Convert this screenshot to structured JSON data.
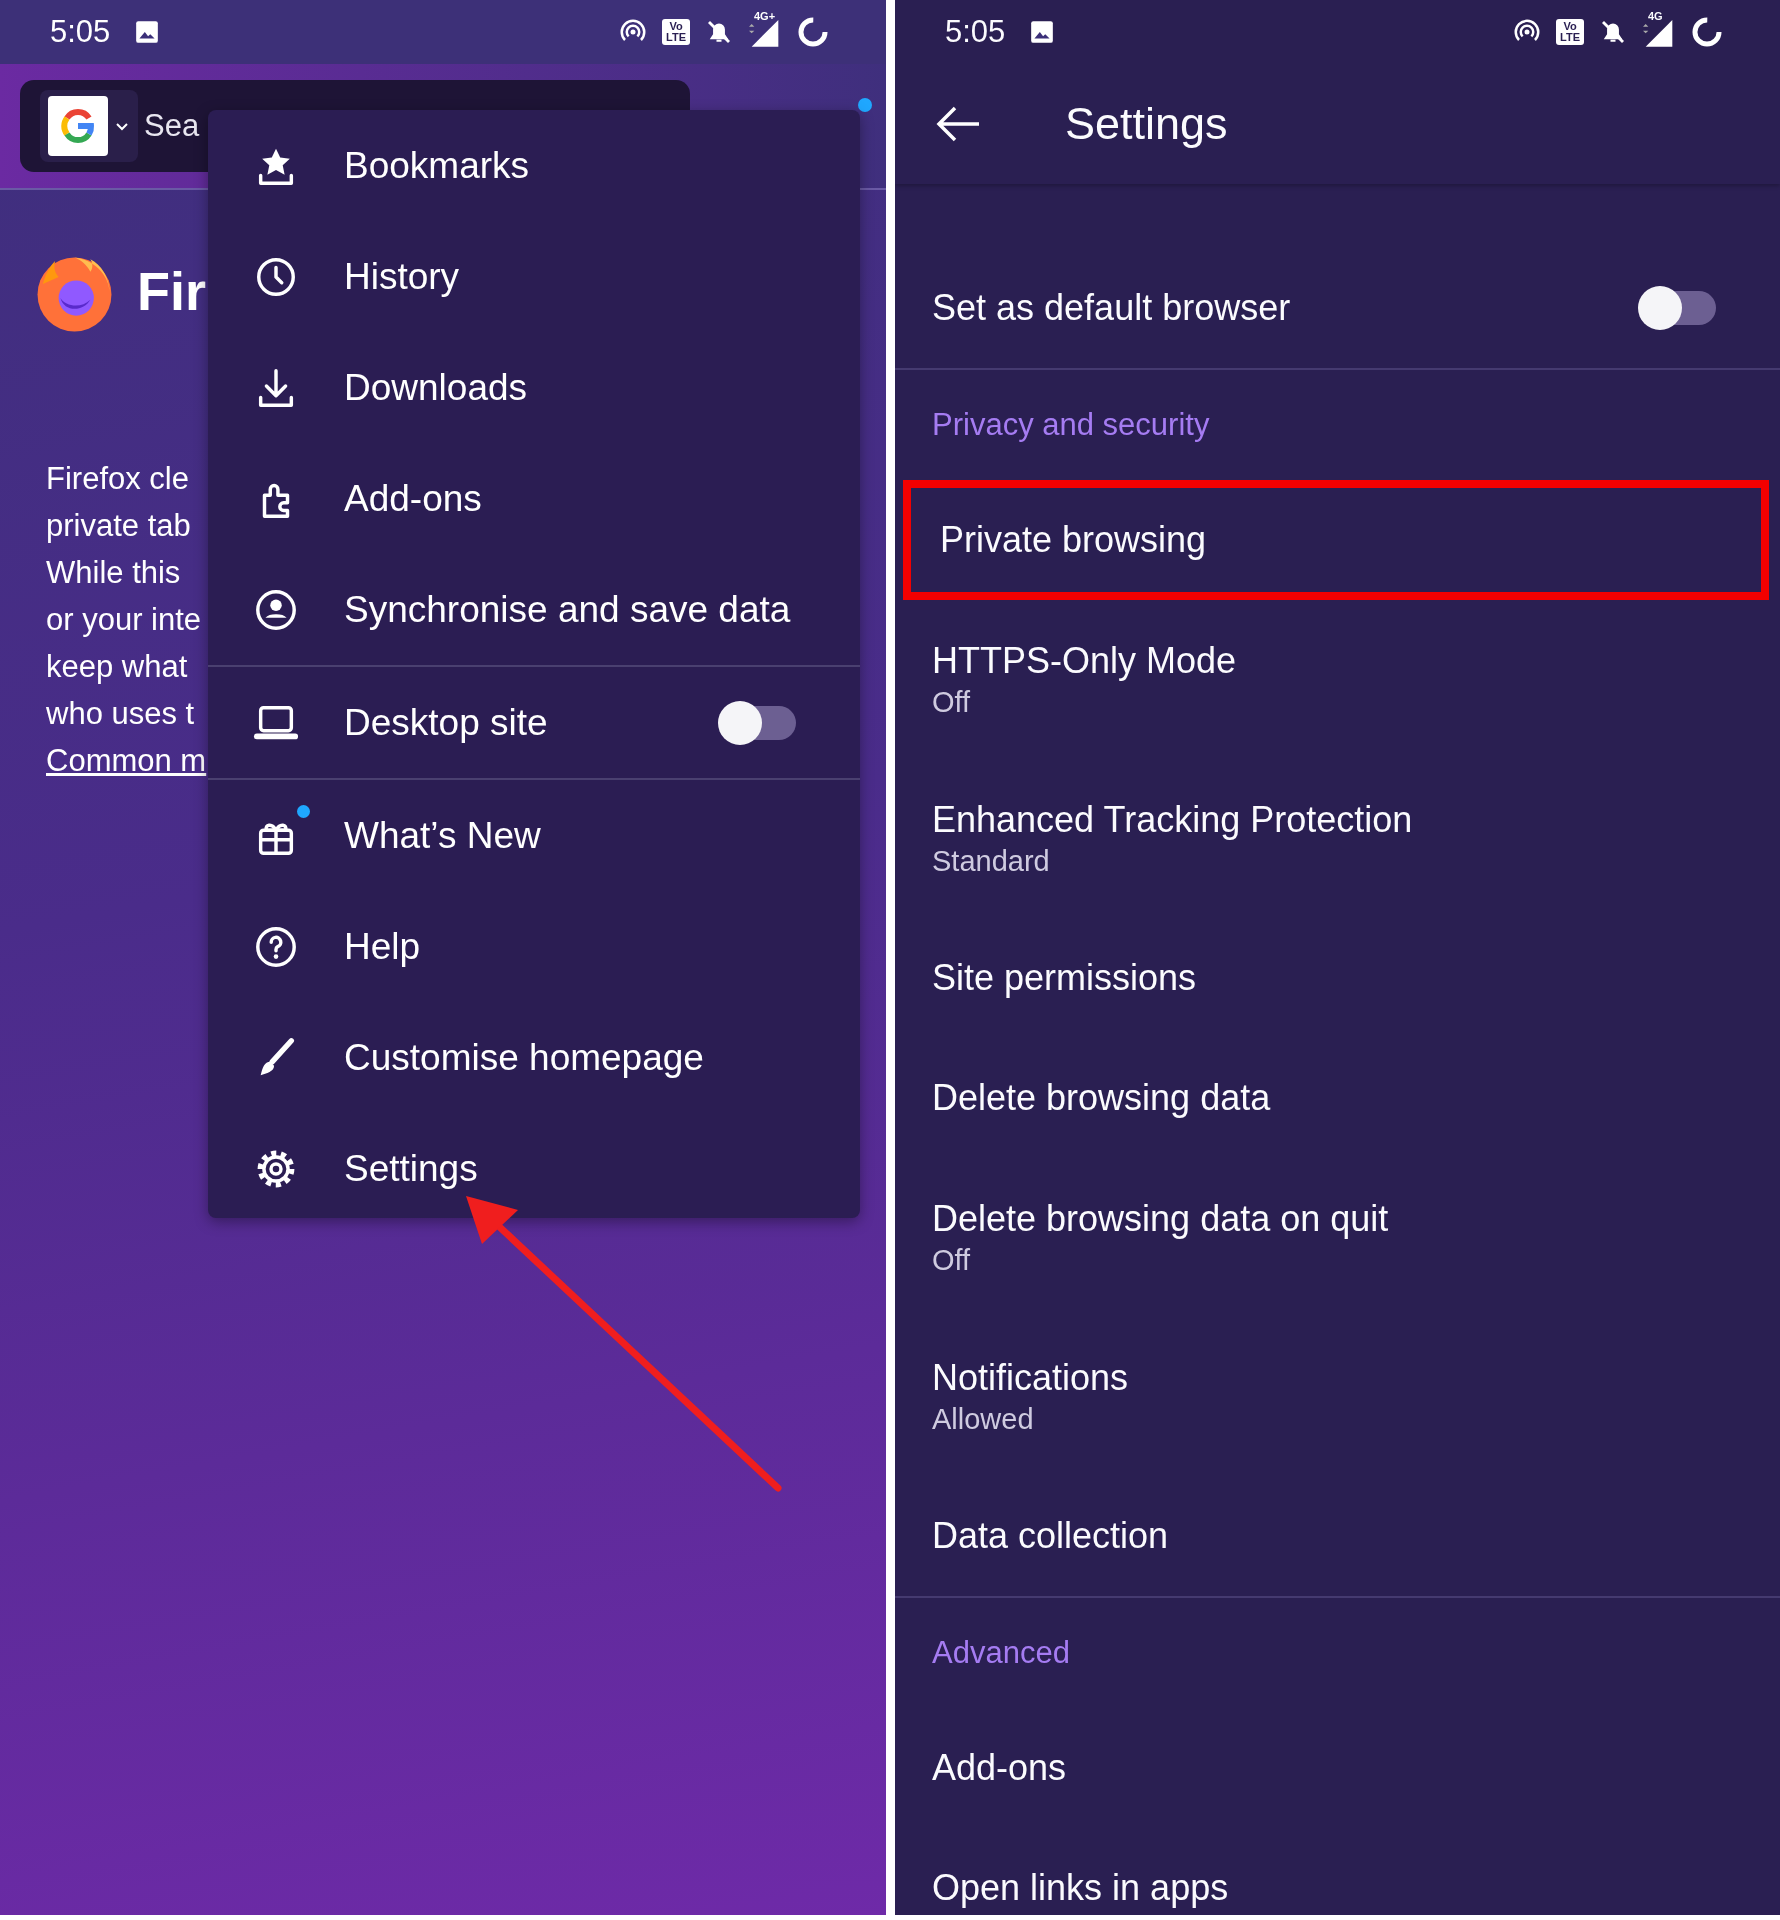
{
  "left_screen": {
    "status_bar": {
      "time": "5:05",
      "volte": "Vo LTE",
      "network": "4G+"
    },
    "search": {
      "placeholder": "Sea"
    },
    "menu_badge": true,
    "home": {
      "title": "Fir",
      "lines": [
        "Firefox cle",
        "private tab",
        "While this",
        "or your inte",
        "keep what",
        "who uses t"
      ],
      "link": "Common m"
    },
    "menu": {
      "sections": [
        [
          {
            "label": "Bookmarks",
            "kind": "item",
            "badge": false
          },
          {
            "label": "History",
            "kind": "item",
            "badge": false
          },
          {
            "label": "Downloads",
            "kind": "item",
            "badge": false
          },
          {
            "label": "Add-ons",
            "kind": "item",
            "badge": false
          },
          {
            "label": "Synchronise and save data",
            "kind": "item",
            "badge": false
          }
        ],
        [
          {
            "label": "Desktop site",
            "kind": "toggle",
            "badge": false,
            "on": false
          }
        ],
        [
          {
            "label": "What’s New",
            "kind": "item",
            "badge": true
          },
          {
            "label": "Help",
            "kind": "item",
            "badge": false
          },
          {
            "label": "Customise homepage",
            "kind": "item",
            "badge": false
          },
          {
            "label": "Settings",
            "kind": "item",
            "badge": false
          }
        ]
      ]
    },
    "annotation": {
      "kind": "arrow"
    }
  },
  "right_screen": {
    "status_bar": {
      "time": "5:05",
      "volte": "Vo LTE",
      "network": "4G"
    },
    "title": "Settings",
    "items": [
      {
        "kind": "toggle",
        "title": "Set as default browser",
        "on": false,
        "highlighted": false
      },
      {
        "kind": "divider"
      },
      {
        "kind": "header",
        "title": "Privacy and security"
      },
      {
        "kind": "row",
        "title": "Private browsing",
        "highlighted": true
      },
      {
        "kind": "row",
        "title": "HTTPS-Only Mode",
        "subtitle": "Off",
        "highlighted": false
      },
      {
        "kind": "row",
        "title": "Enhanced Tracking Protection",
        "subtitle": "Standard",
        "highlighted": false
      },
      {
        "kind": "row",
        "title": "Site permissions",
        "highlighted": false
      },
      {
        "kind": "row",
        "title": "Delete browsing data",
        "highlighted": false
      },
      {
        "kind": "row",
        "title": "Delete browsing data on quit",
        "subtitle": "Off",
        "highlighted": false
      },
      {
        "kind": "row",
        "title": "Notifications",
        "subtitle": "Allowed",
        "highlighted": false
      },
      {
        "kind": "row",
        "title": "Data collection",
        "highlighted": false
      },
      {
        "kind": "divider"
      },
      {
        "kind": "header",
        "title": "Advanced"
      },
      {
        "kind": "row",
        "title": "Add-ons",
        "highlighted": false
      },
      {
        "kind": "row",
        "title": "Open links in apps",
        "highlighted": false
      }
    ]
  }
}
